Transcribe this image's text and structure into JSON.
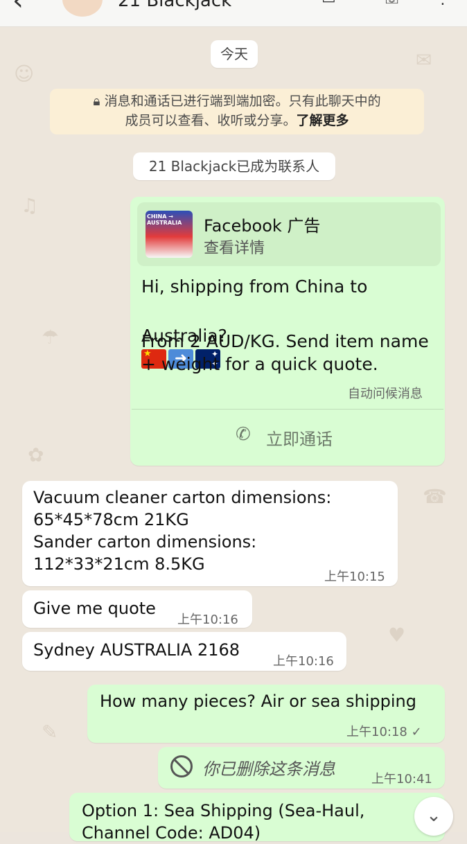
{
  "header": {
    "title": "21 Blackjack",
    "back_icon": "back-arrow-icon",
    "icons": [
      "video-call-icon",
      "voice-call-icon",
      "more-icon"
    ]
  },
  "date_chip": "今天",
  "encryption_notice": {
    "line1": "消息和通话已进行端到端加密。只有此聊天中的",
    "line2": "成员可以查看、收听或分享。",
    "learn_more": "了解更多",
    "icon": "lock-icon"
  },
  "contact_added": "21 Blackjack已成为联系人",
  "ad_message": {
    "ad_title": "Facebook 广告",
    "ad_subtitle": "查看详情",
    "thumb_text": "CHINA → AUSTRALIA",
    "line1": "Hi, shipping from China to",
    "line2": "Australia?",
    "line3": " From 2 AUD/KG. Send item name",
    "line4": "+ weight for a quick quote.",
    "auto_label": "自动问候消息",
    "call_label": "立即通话",
    "call_icon": "phone-icon",
    "emojis": [
      "china-flag-icon",
      "right-arrow-icon",
      "australia-flag-icon"
    ]
  },
  "messages": [
    {
      "text": "Vacuum cleaner carton dimensions:\n65*45*78cm 21KG\nSander carton dimensions:\n112*33*21cm 8.5KG",
      "time": "上午10:15"
    },
    {
      "text": "Give me quote",
      "time": "上午10:16"
    },
    {
      "text": "Sydney AUSTRALIA 2168",
      "time": "上午10:16"
    },
    {
      "text": "How many pieces? Air or sea shipping",
      "time": "上午10:18 ✓"
    },
    {
      "text": "你已删除这条消息",
      "time": "上午10:41"
    },
    {
      "text": "Option 1: Sea Shipping (Sea-Haul,\nChannel Code: AD04)",
      "time": ""
    }
  ],
  "colors": {
    "outgoing_bubble": "#D9FDD3",
    "incoming_bubble": "#FFFFFF",
    "wallpaper": "#EDE6DC",
    "encryption_bg": "#FBEFD6"
  }
}
